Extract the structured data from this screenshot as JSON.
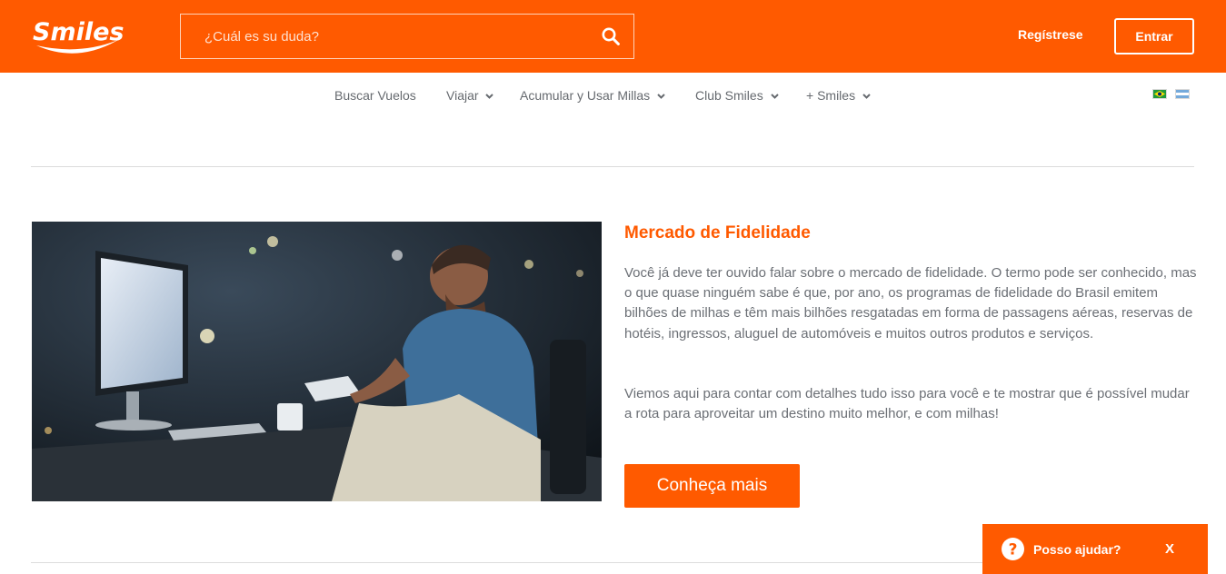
{
  "header": {
    "logo_text": "Smiles",
    "search": {
      "placeholder": "¿Cuál es su duda?",
      "value": ""
    },
    "register_label": "Regístrese",
    "enter_label": "Entrar"
  },
  "nav": {
    "items": [
      {
        "label": "Buscar Vuelos",
        "dropdown": false
      },
      {
        "label": "Viajar",
        "dropdown": true
      },
      {
        "label": "Acumular y Usar Millas",
        "dropdown": true
      },
      {
        "label": "Club Smiles",
        "dropdown": true
      },
      {
        "label": "+ Smiles",
        "dropdown": true
      }
    ],
    "languages": [
      "brazil-flag-icon",
      "argentina-flag-icon"
    ]
  },
  "article": {
    "title": "Mercado de Fidelidade",
    "paragraphs": [
      "Você já deve ter ouvido falar sobre o mercado de fidelidade. O termo pode ser conhecido, mas o que quase ninguém sabe é que, por ano, os programas de fidelidade do Brasil emitem bilhões de milhas e têm mais bilhões resgatadas em forma de passagens aéreas, reservas de hotéis, ingressos, aluguel de automóveis e muitos outros produtos e serviços.",
      "Viemos aqui para contar com detalhes tudo isso para você e te mostrar que é possível mudar a rota para aproveitar um destino muito melhor, e com milhas!"
    ],
    "cta_label": "Conheça mais"
  },
  "help_widget": {
    "label": "Posso ajudar?",
    "close_label": "X"
  },
  "colors": {
    "brand": "#ff5a00",
    "text": "#6b6f75",
    "nav_text": "#666a6f"
  }
}
